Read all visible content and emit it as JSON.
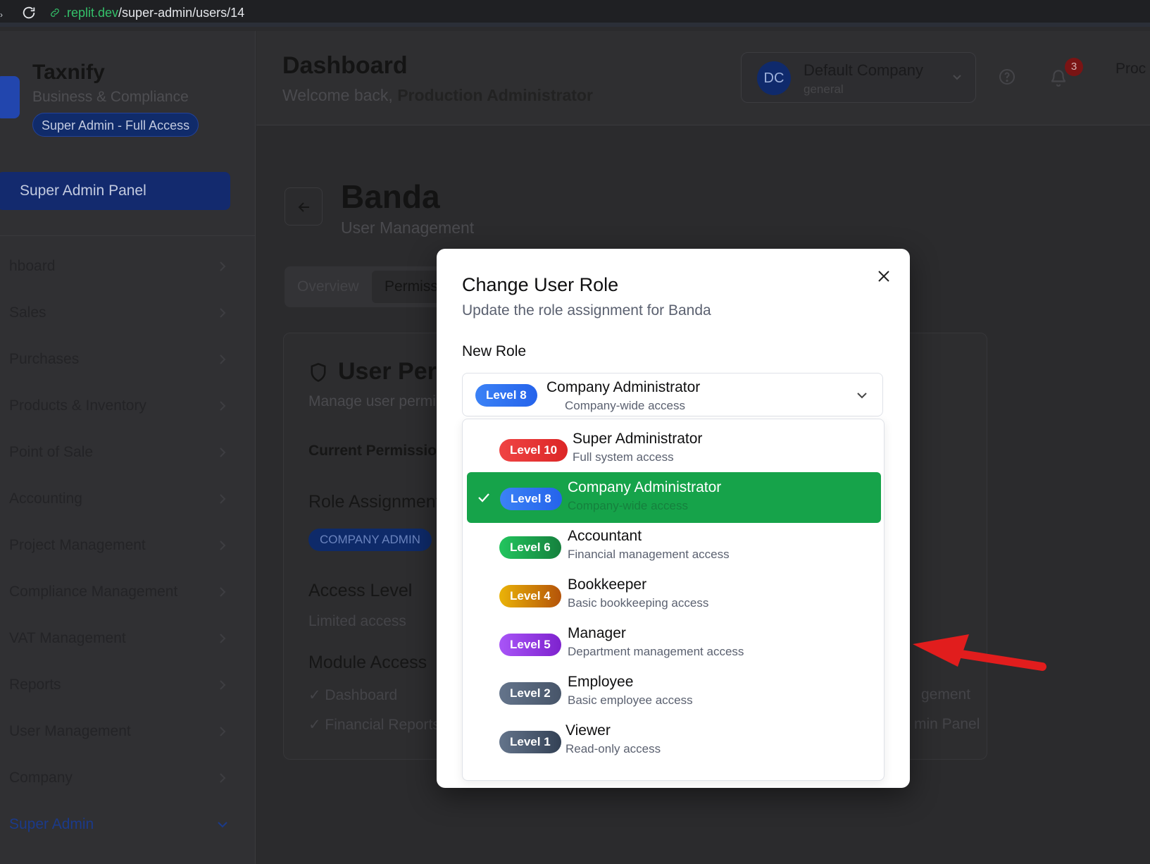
{
  "browser": {
    "url_domain": ".replit.dev",
    "url_path": "/super-admin/users/14"
  },
  "sidebar": {
    "brand": "Taxnify",
    "tagline": "Business & Compliance",
    "access_badge": "Super Admin - Full Access",
    "panel_button": "Super Admin Panel",
    "items": [
      {
        "label": "hboard"
      },
      {
        "label": "Sales"
      },
      {
        "label": "Purchases"
      },
      {
        "label": "Products & Inventory"
      },
      {
        "label": "Point of Sale"
      },
      {
        "label": "Accounting"
      },
      {
        "label": "Project Management"
      },
      {
        "label": "Compliance Management"
      },
      {
        "label": "VAT Management"
      },
      {
        "label": "Reports"
      },
      {
        "label": "User Management"
      },
      {
        "label": "Company"
      },
      {
        "label": "Super Admin"
      }
    ]
  },
  "header": {
    "title": "Dashboard",
    "welcome_prefix": "Welcome back,",
    "user_name": "Production Administrator",
    "company": {
      "initials": "DC",
      "name": "Default Company",
      "type": "general"
    },
    "notifications": "3",
    "profile_partial": "Proc"
  },
  "page": {
    "user_name": "Banda",
    "subtitle": "User Management",
    "tabs": [
      "Overview",
      "Permiss"
    ],
    "card_title": "User Perr",
    "card_subtitle": "Manage user permi",
    "current_permissions": "Current Permission",
    "role_assignment": "Role Assignment",
    "role_badge": "COMPANY ADMIN",
    "access_level_label": "Access Level",
    "access_level_value": "Limited access",
    "module_access": "Module Access",
    "modules_left": [
      "✓ Dashboard",
      "✓ Financial Reports"
    ],
    "modules_right": [
      "gement",
      "min Panel"
    ]
  },
  "modal": {
    "title": "Change User Role",
    "description": "Update the role assignment for Banda",
    "field_label": "New Role",
    "selected": {
      "level": "Level 8",
      "name": "Company Administrator",
      "description": "Company-wide access"
    },
    "options": [
      {
        "level": "Level 10",
        "name": "Super Administrator",
        "description": "Full system access",
        "color": "#dc2626",
        "selected": false
      },
      {
        "level": "Level 8",
        "name": "Company Administrator",
        "description": "Company-wide access",
        "color": "#2563eb",
        "selected": true
      },
      {
        "level": "Level 6",
        "name": "Accountant",
        "description": "Financial management access",
        "color": "#16a34a",
        "selected": false
      },
      {
        "level": "Level 4",
        "name": "Bookkeeper",
        "description": "Basic bookkeeping access",
        "color": "#ca8a04",
        "selected": false
      },
      {
        "level": "Level 5",
        "name": "Manager",
        "description": "Department management access",
        "color": "#9333ea",
        "selected": false
      },
      {
        "level": "Level 2",
        "name": "Employee",
        "description": "Basic employee access",
        "color": "#475569",
        "selected": false
      },
      {
        "level": "Level 1",
        "name": "Viewer",
        "description": "Read-only access",
        "color": "#334155",
        "selected": false
      }
    ]
  },
  "colors": {
    "selected_option": "#16a34a",
    "annotation_arrow": "#e11d1d"
  }
}
